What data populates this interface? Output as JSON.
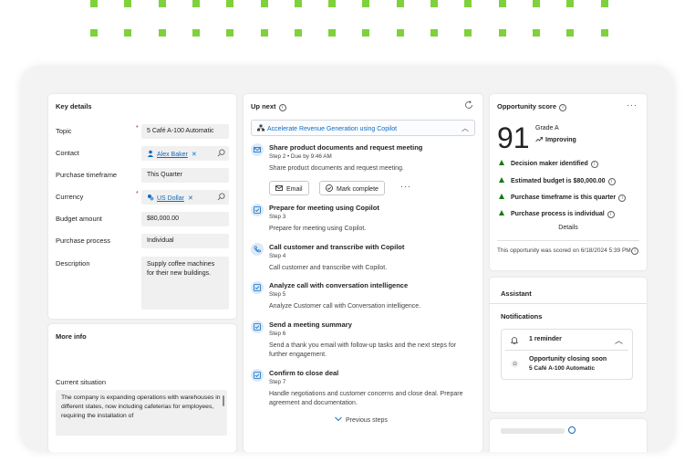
{
  "colors": {
    "accent": "#0f6cbd",
    "positive": "#107c10",
    "required": "#a4262c",
    "decor_green": "#7fd13b"
  },
  "key_details": {
    "title": "Key details",
    "topic_label": "Topic",
    "topic_value": "5 Café A-100 Automatic",
    "contact_label": "Contact",
    "contact_value": "Alex Baker",
    "timeframe_label": "Purchase timeframe",
    "timeframe_value": "This Quarter",
    "currency_label": "Currency",
    "currency_value": "US Dollar",
    "budget_label": "Budget amount",
    "budget_value": "$80,000.00",
    "process_label": "Purchase process",
    "process_value": "Individual",
    "description_label": "Description",
    "description_value": "Supply coffee machines for their new buildings.",
    "required_mark": "*",
    "remove_mark": "✕"
  },
  "more_info": {
    "title": "More info",
    "situation_label": "Current situation",
    "situation_value": "The company is expanding operations with warehouses in different states, now including cafeterias for employees, requiring the installation of"
  },
  "up_next": {
    "title": "Up next",
    "sequence": "Accelerate Revenue Generation using Copilot",
    "steps": [
      {
        "title": "Share product documents and request meeting",
        "sub": "Step 2 • Due by 9:46 AM",
        "desc": "Share product documents and request meeting."
      },
      {
        "title": "Prepare for meeting using Copilot",
        "sub": "Step 3",
        "desc": "Prepare for meeting using Copilot."
      },
      {
        "title": "Call customer and transcribe with Copilot",
        "sub": "Step 4",
        "desc": "Call customer and transcribe with Copilot."
      },
      {
        "title": "Analyze call with conversation intelligence",
        "sub": "Step 5",
        "desc": "Analyze Customer call with Conversation intelligence."
      },
      {
        "title": "Send a meeting summary",
        "sub": "Step 6",
        "desc": "Send a thank you email with follow-up tasks and the next steps for further engagement."
      },
      {
        "title": "Confirm to close deal",
        "sub": "Step 7",
        "desc": "Handle negotiations and customer concerns and close deal. Prepare agreement and documentation."
      }
    ],
    "email_label": "Email",
    "complete_label": "Mark complete",
    "more_label": "···",
    "previous_label": "Previous steps",
    "collapse_chevron": "︿"
  },
  "opportunity_score": {
    "title": "Opportunity score",
    "more_label": "···",
    "score": "91",
    "grade": "Grade A",
    "trend": "Improving",
    "factors": [
      "Decision maker identified",
      "Estimated budget is $80,000.00",
      "Purchase timeframe is this quarter",
      "Purchase process is individual"
    ],
    "details_label": "Details",
    "footer": "This opportunity was scored on 6/18/2024 5:39 PM."
  },
  "assistant": {
    "title": "Assistant",
    "notifications_label": "Notifications",
    "reminder_count": "1 reminder",
    "reminder_chevron": "︿",
    "reminder_title": "Opportunity closing soon",
    "reminder_sub": "5 Café A-100 Automatic"
  }
}
